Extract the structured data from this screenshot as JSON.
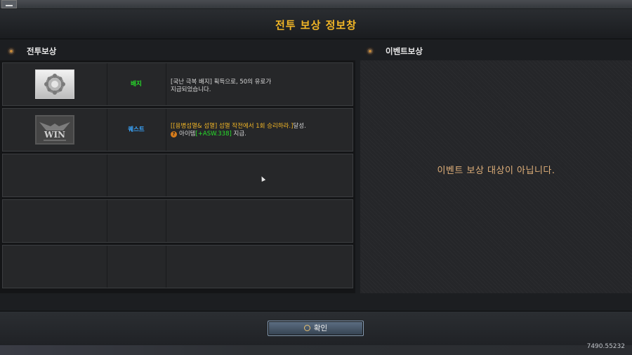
{
  "window": {
    "title": "전투 보상 정보창"
  },
  "battle_rewards": {
    "heading": "전투보상",
    "rows": [
      {
        "type_label": "배지",
        "type_color": "#27e02a",
        "icon": "badge-icon",
        "desc_line1": "[국난 극복 배지] 획득으로, 50의 유로가",
        "desc_line2": "지급되었습니다."
      },
      {
        "type_label": "퀘스트",
        "type_color": "#3aa7ff",
        "icon": "win-emblem-icon",
        "quest_text": "[[용병섬멸& 섬멸] 섬멸 작전에서 1회 승리하라.]",
        "quest_suffix": "달성.",
        "item_prefix": "아이템",
        "item_name": "[+ASW.338]",
        "item_suffix": "지급."
      }
    ],
    "empty_rows": 3
  },
  "event_rewards": {
    "heading": "이벤트보상",
    "message": "이벤트 보상 대상이 아닙니다."
  },
  "confirm_button": {
    "label": "확인"
  },
  "footer": {
    "coords": "7490.55232"
  },
  "colors": {
    "title": "#f2b626",
    "quest_text": "#f2b626",
    "item_name": "#27e02a",
    "event_message": "#e0b07a"
  }
}
